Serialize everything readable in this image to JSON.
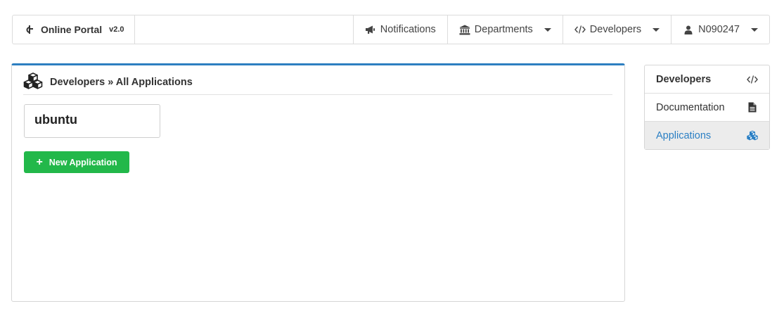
{
  "navbar": {
    "brand_title": "Online Portal",
    "brand_version": "v2.0",
    "items": [
      {
        "label": "Notifications",
        "icon": "bullhorn-icon",
        "dropdown": false
      },
      {
        "label": "Departments",
        "icon": "institution-icon",
        "dropdown": true
      },
      {
        "label": "Developers",
        "icon": "code-icon",
        "dropdown": true
      },
      {
        "label": "N090247",
        "icon": "user-icon",
        "dropdown": true
      }
    ]
  },
  "main": {
    "title": "Developers » All Applications",
    "title_icon": "cubes-icon",
    "applications": [
      {
        "name": "ubuntu"
      }
    ],
    "new_application_label": "New Application"
  },
  "sidebar": {
    "header": "Developers",
    "header_icon": "code-icon",
    "items": [
      {
        "label": "Documentation",
        "icon": "file-text-icon",
        "active": false
      },
      {
        "label": "Applications",
        "icon": "cubes-icon",
        "active": true
      }
    ]
  },
  "colors": {
    "accent_blue": "#2d7fc1",
    "active_link": "#2a7fc4",
    "success_green": "#22b84a",
    "border": "#dcdcdc"
  }
}
